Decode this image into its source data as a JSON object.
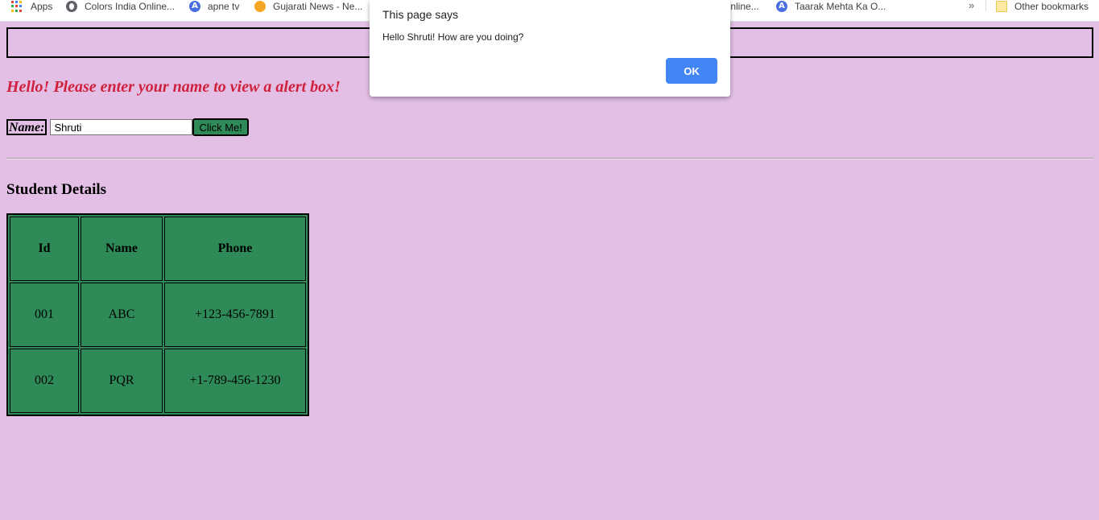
{
  "bookmarks": {
    "apps_label": "Apps",
    "items": [
      {
        "label": "Colors India Online...",
        "icon": "globe-icon"
      },
      {
        "label": "apne tv",
        "icon": "a-logo-icon"
      },
      {
        "label": "Gujarati News - Ne...",
        "icon": "orange-dot-icon"
      },
      {
        "label": "Online...",
        "icon": "none"
      },
      {
        "label": "Taarak Mehta Ka O...",
        "icon": "a-logo-icon"
      }
    ],
    "overflow_label": "»",
    "other_label": "Other bookmarks"
  },
  "page": {
    "greeting": "Hello! Please enter your name to view a alert box!",
    "name_label": "Name:",
    "name_value": "Shruti",
    "button_label": "Click Me!",
    "section_title": "Student Details",
    "colors": {
      "background": "#e3bfe6",
      "table_green": "#2e8b57",
      "greeting_red": "#d0213c"
    }
  },
  "table": {
    "headers": [
      "Id",
      "Name",
      "Phone"
    ],
    "rows": [
      [
        "001",
        "ABC",
        "+123-456-7891"
      ],
      [
        "002",
        "PQR",
        "+1-789-456-1230"
      ]
    ]
  },
  "dialog": {
    "title": "This page says",
    "message": "Hello Shruti! How are you doing?",
    "ok_label": "OK"
  }
}
